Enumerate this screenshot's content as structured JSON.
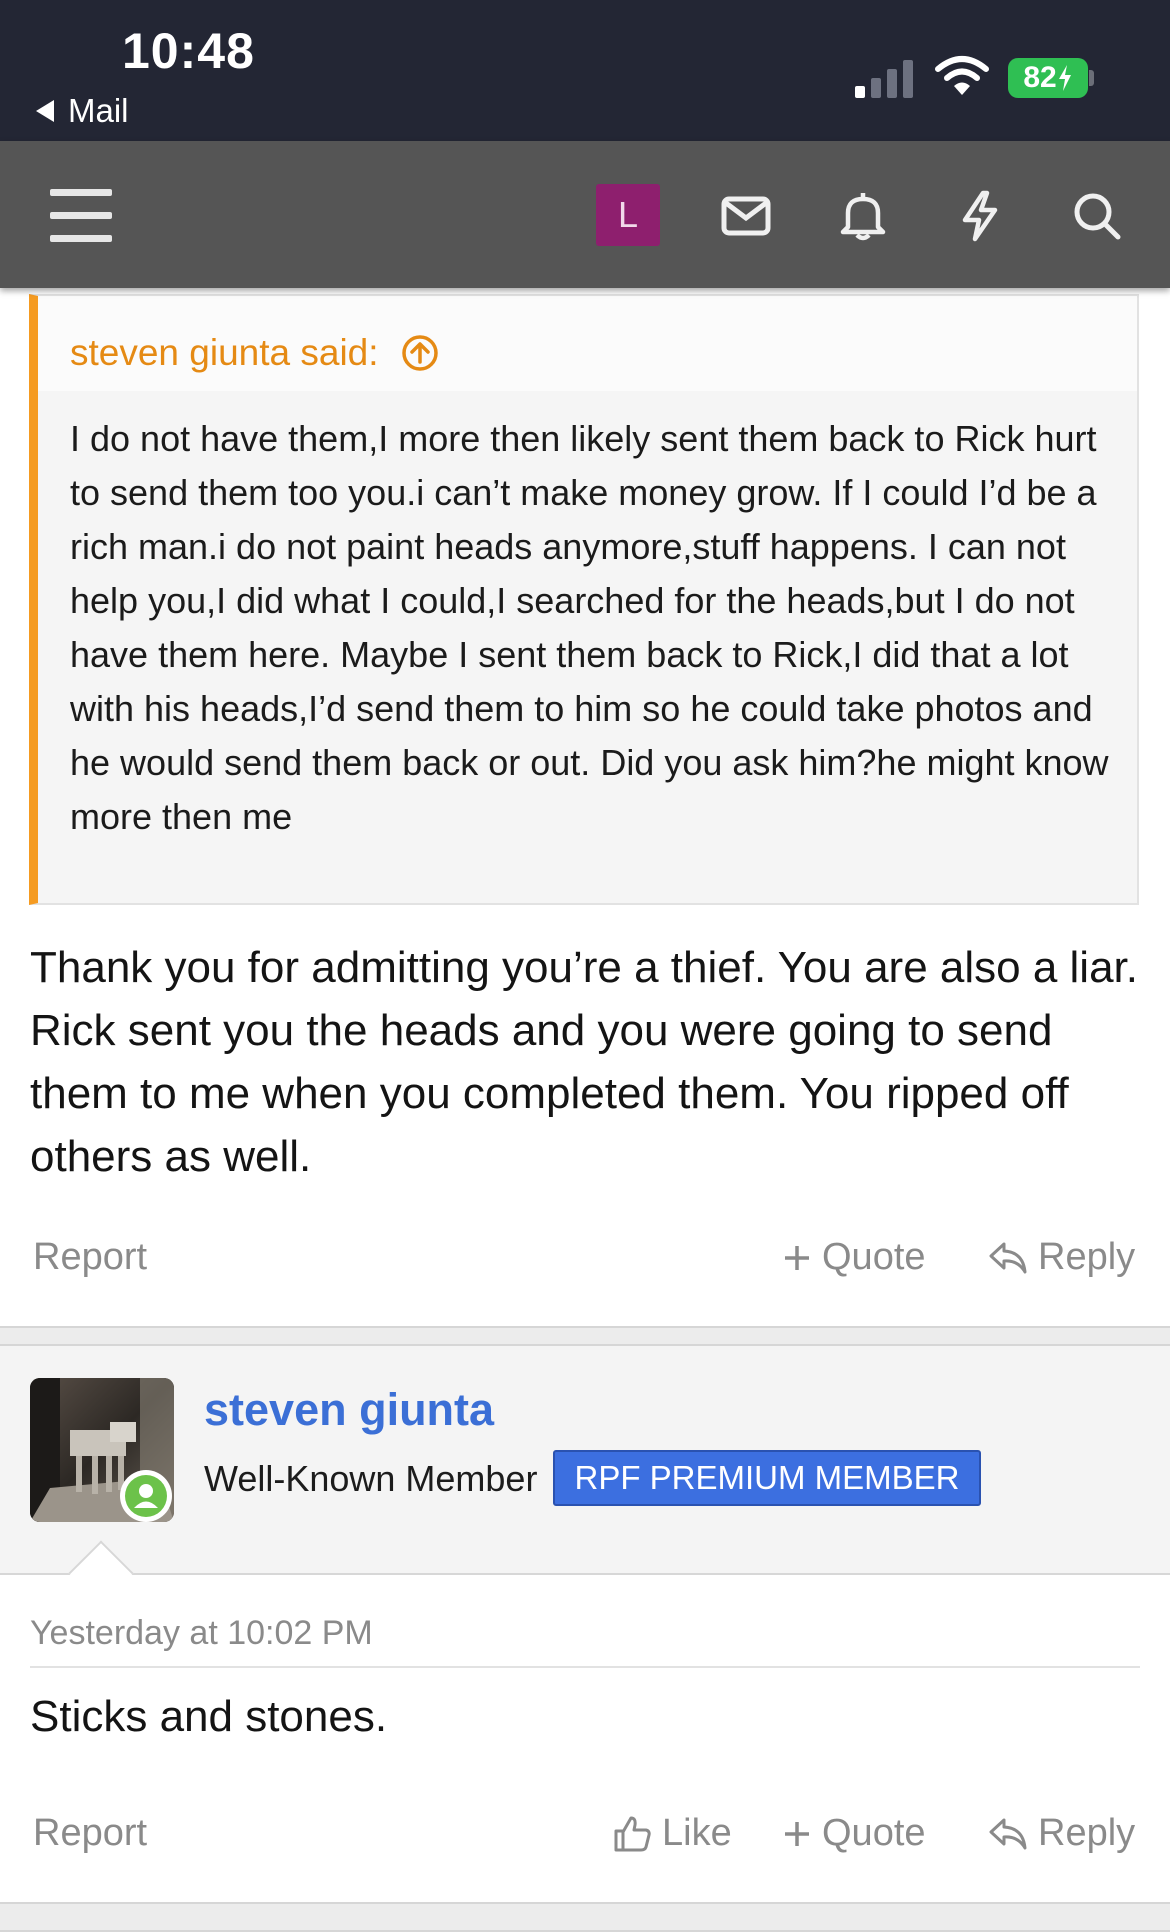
{
  "status_bar": {
    "time": "10:48",
    "back_app": "Mail",
    "battery": "82"
  },
  "navbar": {
    "account_letter": "L",
    "icons": [
      "menu-icon",
      "mail-icon",
      "bell-icon",
      "bolt-icon",
      "search-icon"
    ]
  },
  "quote": {
    "author_label": "steven giunta said:",
    "text": "I do not have them,I more then likely sent them back to Rick hurt to send them too you.i can’t make money grow. If I could I’d be a rich man.i do not paint heads anymore,stuff happens. I can not help you,I did what I could,I searched for the heads,but I do not have them here. Maybe I sent them back to Rick,I did that a lot with his heads,I’d send them to him so he could take photos and he would send them back or out. Did you ask him?he might know more then me"
  },
  "post1": {
    "text": "Thank you for admitting you’re a thief. You are also a liar. Rick sent you the heads and you were going to send them to me when you completed them. You ripped off others as well.",
    "actions": {
      "report": "Report",
      "quote": "Quote",
      "reply": "Reply"
    }
  },
  "post2": {
    "username": "steven giunta",
    "user_title": "Well-Known Member",
    "badge": "RPF PREMIUM MEMBER",
    "date": "Yesterday at 10:02 PM",
    "text": "Sticks and stones.",
    "actions": {
      "report": "Report",
      "like": "Like",
      "quote": "Quote",
      "reply": "Reply"
    }
  },
  "colors": {
    "status_bar_bg": "#232634",
    "navbar_bg": "#555555",
    "quote_accent": "#f59b21",
    "username_blue": "#3b6fd6",
    "badge_blue": "#3c6fe0",
    "avatar_l_bg": "#8e1f6e",
    "online_green": "#6cc24a"
  }
}
